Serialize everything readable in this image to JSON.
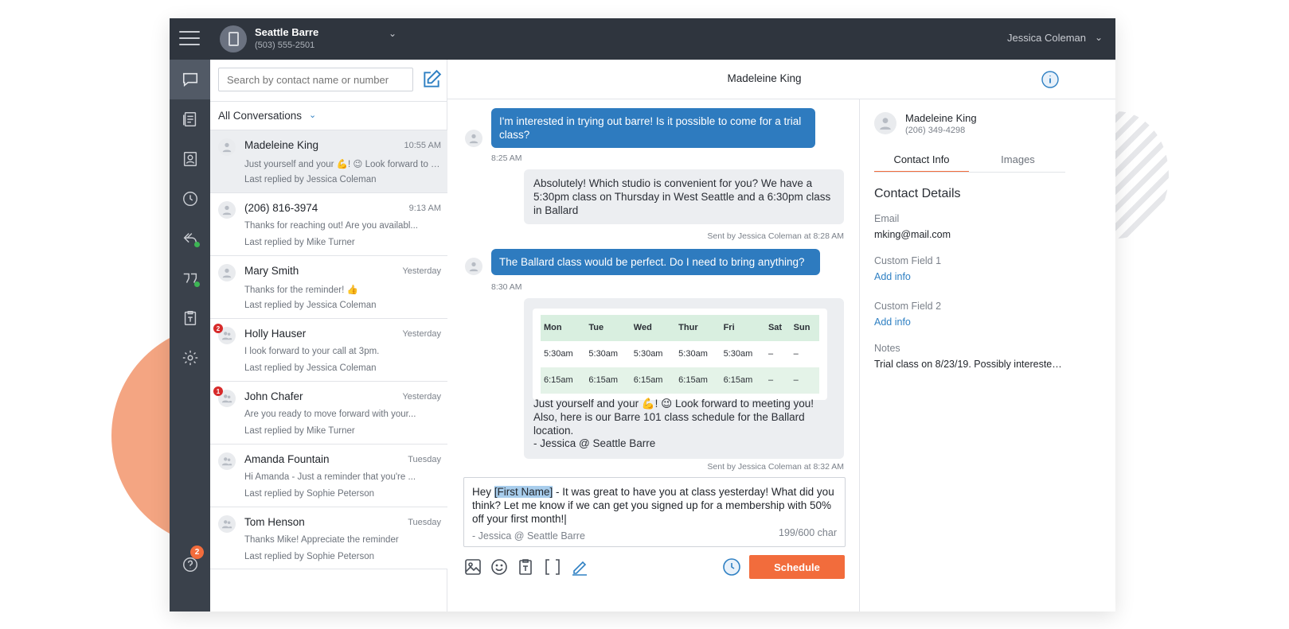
{
  "account": {
    "name": "Seattle Barre",
    "phone": "(503) 555-2501"
  },
  "user": {
    "name": "Jessica Coleman"
  },
  "nav": {
    "items": [
      "messages-icon",
      "campaigns-icon",
      "contacts-icon",
      "scheduled-icon",
      "auto-reply-icon",
      "quotes-icon",
      "templates-icon",
      "settings-icon"
    ],
    "help_badge": "2"
  },
  "search": {
    "placeholder": "Search by contact name or number"
  },
  "filter": {
    "label": "All Conversations"
  },
  "conversations": [
    {
      "name": "Madeleine King",
      "time": "10:55 AM",
      "preview": "Just yourself and your 💪! 😉 Look forward to …",
      "last": "Last replied by Jessica Coleman",
      "badge": ""
    },
    {
      "name": "(206) 816-3974",
      "time": "9:13 AM",
      "preview": "Thanks for reaching out! Are you availabl...",
      "last": "Last replied by Mike Turner",
      "badge": ""
    },
    {
      "name": "Mary Smith",
      "time": "Yesterday",
      "preview": "Thanks for the reminder! 👍",
      "last": "Last replied by Jessica Coleman",
      "badge": ""
    },
    {
      "name": "Holly Hauser",
      "time": "Yesterday",
      "preview": "I look forward to your call at 3pm.",
      "last": "Last replied by Jessica Coleman",
      "badge": "2"
    },
    {
      "name": "John Chafer",
      "time": "Yesterday",
      "preview": "Are you ready to move forward with your...",
      "last": "Last replied by Mike Turner",
      "badge": "1"
    },
    {
      "name": "Amanda Fountain",
      "time": "Tuesday",
      "preview": "Hi Amanda - Just a reminder that you're ...",
      "last": "Last replied by Sophie Peterson",
      "badge": ""
    },
    {
      "name": "Tom Henson",
      "time": "Tuesday",
      "preview": "Thanks Mike! Appreciate the reminder",
      "last": "Last replied by Sophie Peterson",
      "badge": ""
    }
  ],
  "chat": {
    "title": "Madeleine King",
    "messages": [
      {
        "text": "I'm interested in trying out barre! Is it possible to come for a trial class?",
        "meta": "8:25 AM"
      },
      {
        "text": "Absolutely! Which studio is convenient for you? We have a 5:30pm class on Thursday in West Seattle and a 6:30pm class in Ballard",
        "meta": "Sent by Jessica Coleman at 8:28 AM"
      },
      {
        "text": "The Ballard class would be perfect. Do I need to bring anything?",
        "meta": "8:30 AM"
      },
      {
        "text1": "Just yourself and your 💪! 😉 Look forward to meeting you! Also, here is our Barre 101 class schedule for the Ballard location.",
        "text2": "- Jessica @ Seattle Barre",
        "meta": "Sent by Jessica Coleman at 8:32 AM"
      }
    ],
    "schedule": {
      "days": [
        "Mon",
        "Tue",
        "Wed",
        "Thur",
        "Fri",
        "Sat",
        "Sun"
      ],
      "rows": [
        [
          "5:30am",
          "5:30am",
          "5:30am",
          "5:30am",
          "5:30am",
          "–",
          "–"
        ],
        [
          "6:15am",
          "6:15am",
          "6:15am",
          "6:15am",
          "6:15am",
          "–",
          "–"
        ]
      ]
    },
    "composer": {
      "before": "Hey ",
      "token": "[First Name]",
      "after": " - It was great to have you at class yesterday! What did you think? Let me know if we can get you signed up for a membership with 50% off your first month!|",
      "signature": "- Jessica @ Seattle Barre",
      "count": "199/600 char"
    },
    "schedule_button": "Schedule"
  },
  "contact": {
    "name": "Madeleine King",
    "phone": "(206) 349-4298",
    "tabs": [
      "Contact Info",
      "Images"
    ],
    "section_title": "Contact Details",
    "email_label": "Email",
    "email": "mking@mail.com",
    "custom1_label": "Custom Field 1",
    "custom1_link": "Add info",
    "custom2_label": "Custom Field 2",
    "custom2_link": "Add info",
    "notes_label": "Notes",
    "notes": "Trial class on 8/23/19. Possibly interested..."
  },
  "colors": {
    "accent": "#f26c3c",
    "incoming_bubble": "#2e7bbf",
    "sidebar": "#3a414b",
    "topbar": "#2f353e"
  }
}
